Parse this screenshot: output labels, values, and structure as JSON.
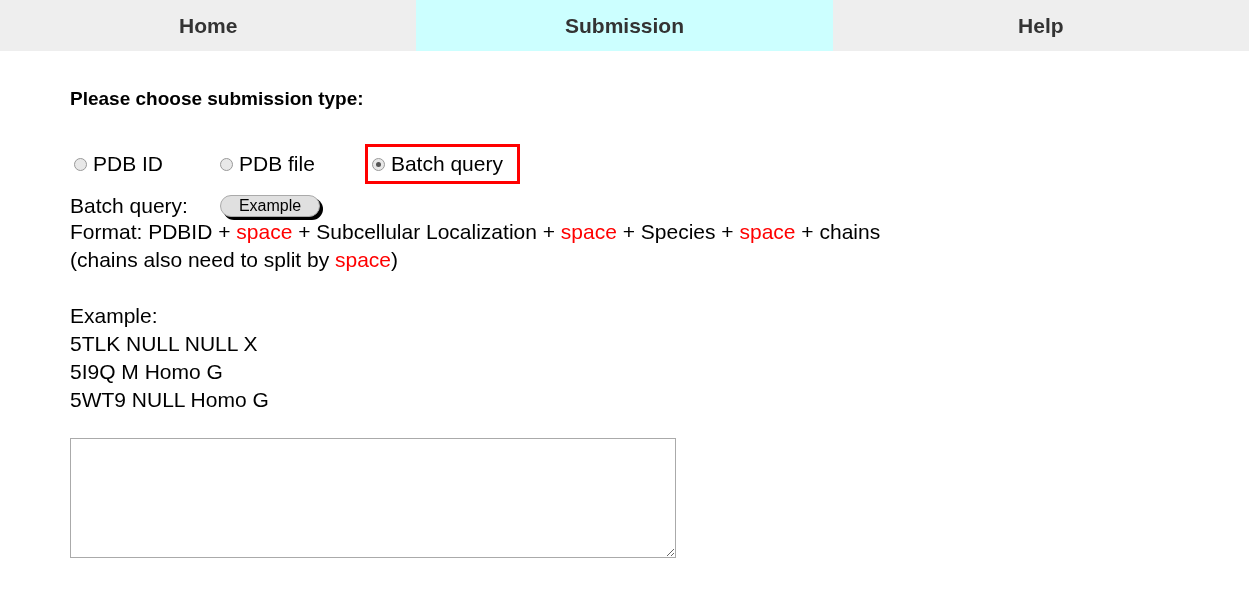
{
  "nav_tabs": [
    {
      "label": "Home",
      "selected": false
    },
    {
      "label": "Submission",
      "selected": true
    },
    {
      "label": "Help",
      "selected": false
    }
  ],
  "heading": "Please choose submission type:",
  "submission_types": [
    {
      "label": "PDB ID",
      "selected": false,
      "highlighted": false
    },
    {
      "label": "PDB file",
      "selected": false,
      "highlighted": false
    },
    {
      "label": "Batch query",
      "selected": true,
      "highlighted": true
    }
  ],
  "batch_label": "Batch query:",
  "example_button": "Example",
  "format_lines": [
    [
      {
        "text": "Format: PDBID + ",
        "kind": "plain"
      },
      {
        "text": "space",
        "kind": "highlight"
      },
      {
        "text": " + Subcellular Localization + ",
        "kind": "plain"
      },
      {
        "text": "space",
        "kind": "highlight"
      },
      {
        "text": " + Species + ",
        "kind": "plain"
      },
      {
        "text": "space",
        "kind": "highlight"
      },
      {
        "text": " + chains",
        "kind": "plain"
      }
    ],
    [
      {
        "text": "(chains also need to split by ",
        "kind": "plain"
      },
      {
        "text": "space",
        "kind": "highlight"
      },
      {
        "text": ")",
        "kind": "plain"
      }
    ]
  ],
  "example_label": "Example:",
  "example_lines": [
    "5TLK NULL NULL X",
    "5I9Q M Homo G",
    "5WT9 NULL Homo G"
  ]
}
